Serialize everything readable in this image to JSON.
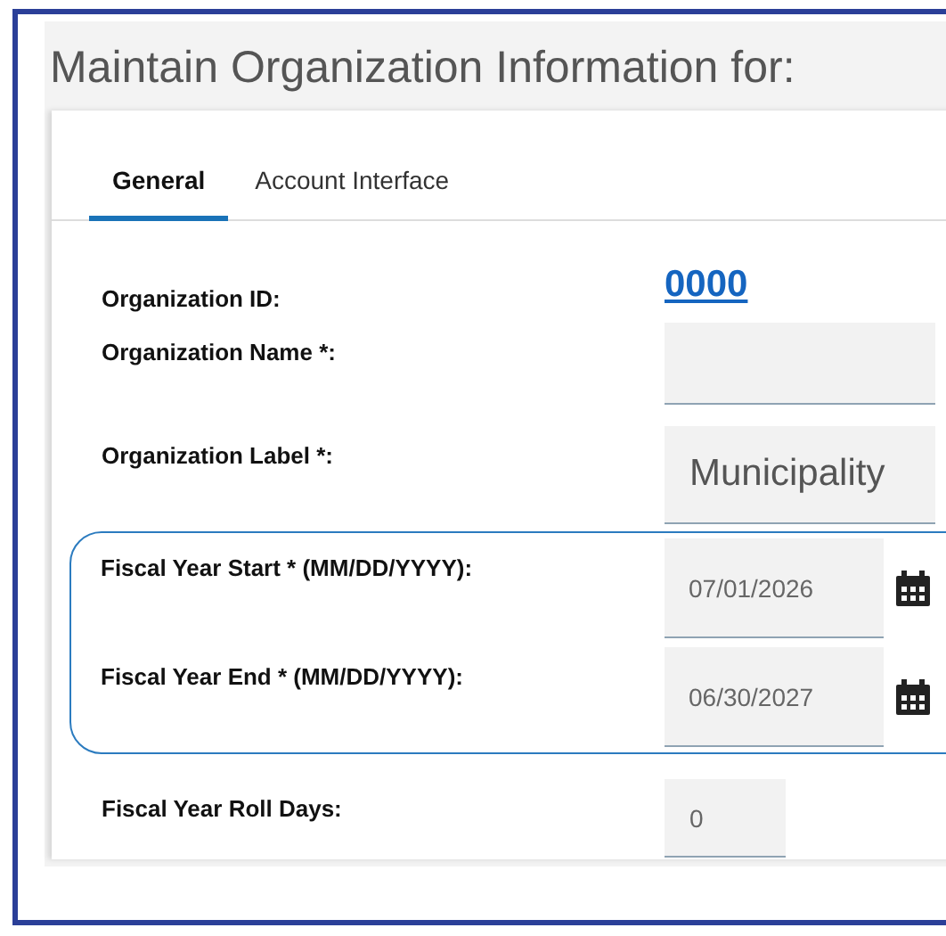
{
  "title": "Maintain Organization Information for:",
  "tabs": [
    {
      "label": "General",
      "selected": true
    },
    {
      "label": "Account Interface",
      "selected": false
    }
  ],
  "fields": [
    {
      "label": "Organization ID:",
      "kind": "link",
      "value": "0000"
    },
    {
      "label": "Organization Name *:",
      "kind": "text",
      "highlighted": false
    },
    {
      "label": "Organization Label *:",
      "kind": "text",
      "value": "Municipality",
      "highlighted": false
    },
    {
      "label": "Fiscal Year Start * (MM/DD/YYYY):",
      "kind": "date",
      "value": "07/01/2026",
      "highlighted": true
    },
    {
      "label": "Fiscal Year End * (MM/DD/YYYY):",
      "kind": "date",
      "value": "06/30/2027",
      "highlighted": true
    },
    {
      "label": "Fiscal Year Roll Days:",
      "kind": "number",
      "value": "0",
      "highlighted": false
    }
  ]
}
